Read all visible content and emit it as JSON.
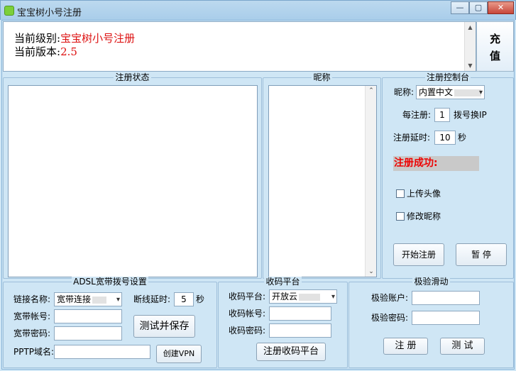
{
  "window": {
    "title": "宝宝树小号注册",
    "controls": [
      "—",
      "▢",
      "✕"
    ]
  },
  "info": {
    "level_label": "当前级别:",
    "level_value": "宝宝树小号注册",
    "version_label": "当前版本:",
    "version_value": "2.5"
  },
  "charge_button": {
    "line1": "充",
    "line2": "值"
  },
  "reg_status": {
    "title": "注册状态"
  },
  "nickname": {
    "title": "昵称"
  },
  "control": {
    "title": "注册控制台",
    "nick_label": "昵称:",
    "nick_select": "内置中文",
    "per_reg_label": "每注册:",
    "per_reg_value": "1",
    "per_reg_suffix": "拨号换IP",
    "delay_label": "注册延时:",
    "delay_value": "10",
    "delay_unit": "秒",
    "status_text": "注册成功:",
    "upload_avatar": "上传头像",
    "upload_avatar_checked": false,
    "modify_nick": "修改昵称",
    "modify_nick_checked": false,
    "start_button": "开始注册",
    "pause_button": "暂 停"
  },
  "adsl": {
    "title": "ADSL宽带拨号设置",
    "link_label": "链接名称:",
    "link_value": "宽带连接",
    "disconnect_label": "断线延时:",
    "disconnect_value": "5",
    "disconnect_unit": "秒",
    "account_label": "宽带帐号:",
    "password_label": "宽带密码:",
    "pptp_label": "PPTP域名:",
    "test_save_button": "测试并保存",
    "create_vpn_button": "创建VPN"
  },
  "sms": {
    "title": "收码平台",
    "platform_label": "收码平台:",
    "platform_value": "开放云",
    "account_label": "收码帐号:",
    "password_label": "收码密码:",
    "register_button": "注册收码平台"
  },
  "captcha": {
    "title": "极验滑动",
    "account_label": "极验账户:",
    "password_label": "极验密码:",
    "register_button": "注 册",
    "test_button": "测 试"
  },
  "colors": {
    "value_red": "#dd1111",
    "client_bg": "#cfe6f5",
    "titlebar": "#a9cdea"
  }
}
